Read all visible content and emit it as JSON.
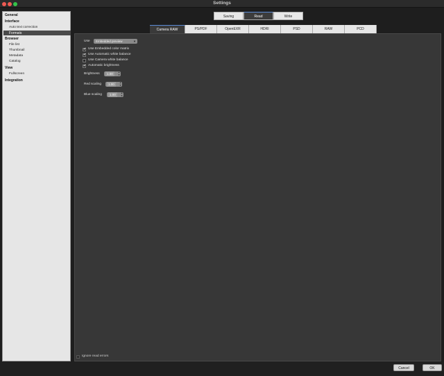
{
  "window": {
    "title": "Settings"
  },
  "sidebar": {
    "items": [
      {
        "label": "General",
        "type": "category"
      },
      {
        "label": "Interface",
        "type": "category"
      },
      {
        "label": "Auto text correction",
        "type": "item"
      },
      {
        "label": "Formats",
        "type": "item",
        "selected": true
      },
      {
        "label": "Browser",
        "type": "category"
      },
      {
        "label": "File list",
        "type": "item"
      },
      {
        "label": "Thumbnail",
        "type": "item"
      },
      {
        "label": "Metadata",
        "type": "item"
      },
      {
        "label": "Catalog",
        "type": "item"
      },
      {
        "label": "View",
        "type": "category"
      },
      {
        "label": "Fullscreen",
        "type": "item"
      },
      {
        "label": "Integration",
        "type": "category"
      }
    ]
  },
  "top_tabs": [
    {
      "label": "Saving"
    },
    {
      "label": "Read",
      "active": true
    },
    {
      "label": "Write"
    }
  ],
  "sub_tabs": [
    {
      "label": "Camera RAW",
      "active": true
    },
    {
      "label": "PS/PDF"
    },
    {
      "label": "OpenEXR"
    },
    {
      "label": "HDRI"
    },
    {
      "label": "PSD"
    },
    {
      "label": "RAW"
    },
    {
      "label": "PCD"
    }
  ],
  "form": {
    "use_label": "Use",
    "use_value": "Embedded preview",
    "checkboxes": [
      {
        "label": "Use Embedded color matrix",
        "checked": true
      },
      {
        "label": "Use Automatic white balance",
        "checked": true
      },
      {
        "label": "Use Camera white balance",
        "checked": false
      },
      {
        "label": "Automatic brightness",
        "checked": true
      }
    ],
    "brightness_label": "Brightness",
    "brightness_value": "1.00",
    "red_label": "Red scaling",
    "red_value": "1.00",
    "blue_label": "Blue scaling",
    "blue_value": "1.00"
  },
  "ignore_errors": {
    "label": "Ignore read errors",
    "checked": false
  },
  "buttons": {
    "cancel": "Cancel",
    "ok": "OK"
  }
}
